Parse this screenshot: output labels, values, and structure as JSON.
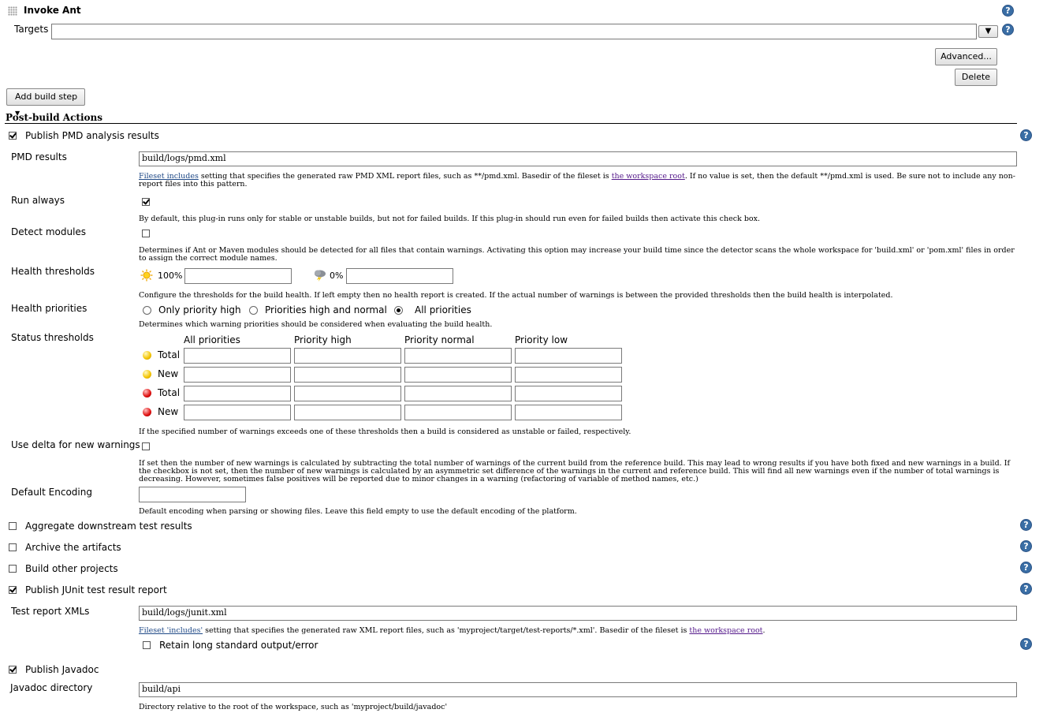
{
  "invoke_ant": {
    "title": "Invoke Ant",
    "targets_label": "Targets",
    "targets_value": "",
    "dropdown_glyph": "▼",
    "advanced_label": "Advanced...",
    "delete_label": "Delete"
  },
  "add_build_step_label": "Add build step",
  "post_build_title": "Post-build Actions",
  "pmd": {
    "label": "Publish PMD analysis results",
    "checked": true,
    "results_label": "PMD results",
    "results_value": "build/logs/pmd.xml",
    "results_desc": {
      "link1": "Fileset includes",
      "text1": " setting that specifies the generated raw PMD XML report files, such as **/pmd.xml. Basedir of the fileset is ",
      "link2": "the workspace root",
      "text2": ". If no value is set, then the default **/pmd.xml is used. Be sure not to include any non-report files into this pattern."
    },
    "run_always_label": "Run always",
    "run_always_desc": "By default, this plug-in runs only for stable or unstable builds, but not for failed builds. If this plug-in should run even for failed builds then activate this check box.",
    "detect_modules_label": "Detect modules",
    "detect_modules_desc": "Determines if Ant or Maven modules should be detected for all files that contain warnings. Activating this option may increase your build time since the detector scans the whole workspace for 'build.xml' or 'pom.xml' files in order to assign the correct module names.",
    "health_thresholds_label": "Health thresholds",
    "health_100": "100%",
    "health_0": "0%",
    "health_thresholds_desc": "Configure the thresholds for the build health. If left empty then no health report is created. If the actual number of warnings is between the provided thresholds then the build health is interpolated.",
    "health_priorities_label": "Health priorities",
    "priority_options": [
      "Only priority high",
      "Priorities high and normal",
      "All priorities"
    ],
    "priority_selected": "All priorities",
    "health_priorities_desc": "Determines which warning priorities should be considered when evaluating the build health.",
    "status_thresholds_label": "Status thresholds",
    "status_columns": [
      "All priorities",
      "Priority high",
      "Priority normal",
      "Priority low"
    ],
    "status_rows": [
      {
        "icon": "yellow-ball-icon",
        "label": "Total"
      },
      {
        "icon": "yellow-ball-icon",
        "label": "New"
      },
      {
        "icon": "red-ball-icon",
        "label": "Total"
      },
      {
        "icon": "red-ball-icon",
        "label": "New"
      }
    ],
    "status_desc": "If the specified number of warnings exceeds one of these thresholds then a build is considered as unstable or failed, respectively.",
    "use_delta_label": "Use delta for new warnings",
    "use_delta_desc": "If set then the number of new warnings is calculated by subtracting the total number of warnings of the current build from the reference build. This may lead to wrong results if you have both fixed and new warnings in a build. If the checkbox is not set, then the number of new warnings is calculated by an asymmetric set difference of the warnings in the current and reference build. This will find all new warnings even if the number of total warnings is decreasing. However, sometimes false positives will be reported due to minor changes in a warning (refactoring of variable of method names, etc.)",
    "encoding_label": "Default Encoding",
    "encoding_desc": "Default encoding when parsing or showing files. Leave this field empty to use the default encoding of the platform."
  },
  "aggregate_label": "Aggregate downstream test results",
  "archive_label": "Archive the artifacts",
  "build_other_label": "Build other projects",
  "junit": {
    "label": "Publish JUnit test result report",
    "xml_label": "Test report XMLs",
    "xml_value": "build/logs/junit.xml",
    "desc_link1": "Fileset 'includes'",
    "desc_text1": " setting that specifies the generated raw XML report files, such as 'myproject/target/test-reports/*.xml'. Basedir of the fileset is ",
    "desc_link2": "the workspace root",
    "desc_text2": ".",
    "retain_label": "Retain long standard output/error"
  },
  "javadoc": {
    "label": "Publish Javadoc",
    "dir_label": "Javadoc directory",
    "dir_value": "build/api",
    "desc": "Directory relative to the root of the workspace, such as 'myproject/build/javadoc'"
  },
  "help_glyph": "?"
}
